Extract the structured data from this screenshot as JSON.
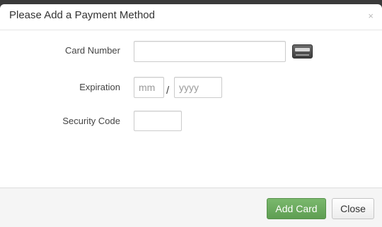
{
  "modal": {
    "title": "Please Add a Payment Method",
    "close_glyph": "×"
  },
  "form": {
    "card_number": {
      "label": "Card Number",
      "value": "",
      "placeholder": ""
    },
    "expiration": {
      "label": "Expiration",
      "month_placeholder": "mm",
      "separator": "/",
      "year_placeholder": "yyyy"
    },
    "security_code": {
      "label": "Security Code",
      "value": "",
      "placeholder": ""
    }
  },
  "icons": {
    "card": "credit-card-icon"
  },
  "footer": {
    "add_card_label": "Add Card",
    "close_label": "Close"
  },
  "colors": {
    "primary_button": "#6aa85e",
    "footer_bg": "#f5f5f5"
  }
}
